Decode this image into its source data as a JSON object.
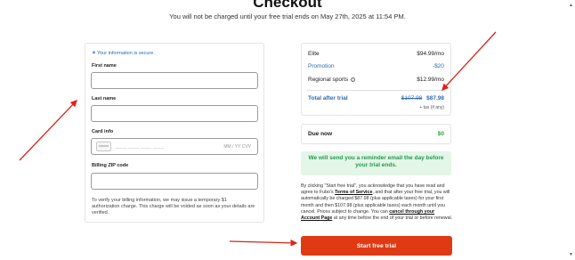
{
  "header": {
    "title": "Checkout",
    "subtitle": "You will not be charged until your free trial ends on May 27th, 2025 at 11:54 PM."
  },
  "form": {
    "secure_label": "Your information is secure.",
    "first_name_label": "First name",
    "first_name_value": "",
    "last_name_label": "Last name",
    "last_name_value": "",
    "card_label": "Card info",
    "card_number_placeholder": "____ ____ ____ ____",
    "card_expiry_cvv_placeholder": "MM / YY  CVV",
    "zip_label": "Billing ZIP code",
    "zip_value": "",
    "verify_note": "To verify your billing information, we may issue a temporary $1 authorization charge. This charge will be voided as soon as your details are verified."
  },
  "summary": {
    "items": [
      {
        "label": "Elite",
        "value": "$94.99/mo",
        "accent": false
      },
      {
        "label": "Promotion",
        "value": "-$20",
        "accent": true
      },
      {
        "label": "Regional sports",
        "value": "$12.99/mo",
        "accent": false
      }
    ],
    "total_label": "Total after trial",
    "total_old": "$107.98",
    "total_new": "$87.98",
    "tax_note": "+ tax (if any)",
    "due_label": "Due now",
    "due_value": "$0",
    "reminder": "We will send you a reminder email the day before your trial ends."
  },
  "legal": {
    "part1": "By clicking \"Start free trial\", you acknowledge that you have read and agree to Fubo's ",
    "terms_link": "Terms of Service",
    "part2": ", and that after your free trial, you will automatically be charged $87.98 (plus applicable taxes) for your first month and then $107.98 (plus applicable taxes) each month until you cancel. Prices subject to change. You can ",
    "cancel_link": "cancel through your Account Page",
    "part3": " at any time before the end of your trial or before renewal."
  },
  "cta_label": "Start free trial",
  "colors": {
    "accent_blue": "#2b6cb0",
    "cta_red": "#e03a15",
    "success_green": "#1f9d4a",
    "reminder_bg": "#e3f6e8",
    "annotation_red": "#d9241c"
  },
  "icons": {
    "secure": "lock-icon",
    "info": "info-icon",
    "card": "credit-card-icon"
  }
}
